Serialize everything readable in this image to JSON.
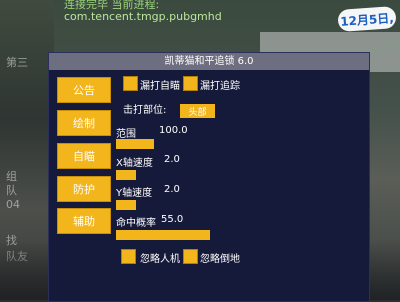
{
  "background": {
    "top_text": "连接完毕 当前进程:",
    "url_text": "com.tencent.tmgp.pubgmhd",
    "date_badge": "12月5日,",
    "left_texts": [
      "第三",
      "组",
      "队",
      "04",
      "找",
      "队友"
    ]
  },
  "panel": {
    "title": "凯蒂猫和平追锁 6.0",
    "tabs": [
      "公告",
      "绘制",
      "自瞄",
      "防护",
      "辅助"
    ],
    "options": {
      "aim_bot_label": "漏打自瞄",
      "aim_track_label": "漏打追踪",
      "aim_part_label": "击打部位:",
      "aim_part_value": "头部",
      "ignore_bot_label": "忽略人机",
      "ignore_down_label": "忽略倒地"
    },
    "sliders": [
      {
        "label": "范围",
        "value": "100.0",
        "fill": 0.29
      },
      {
        "label": "X轴速度",
        "value": "2.0",
        "fill": 0.15
      },
      {
        "label": "Y轴速度",
        "value": "2.0",
        "fill": 0.15
      },
      {
        "label": "命中概率",
        "value": "55.0",
        "fill": 0.72
      }
    ]
  },
  "colors": {
    "accent": "#f2b51b",
    "panel_bg": "#161a3a",
    "title_bg": "#6d6e7f"
  }
}
